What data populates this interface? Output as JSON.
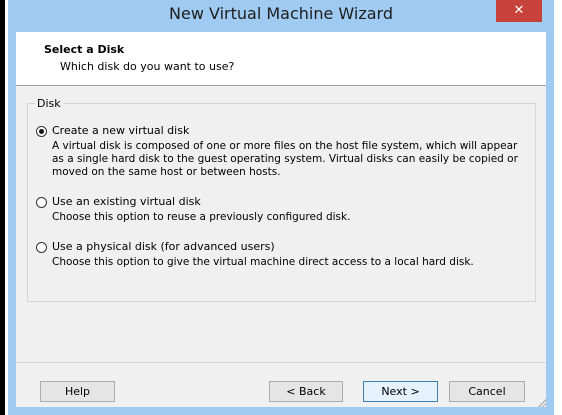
{
  "window": {
    "title": "New Virtual Machine Wizard",
    "close_glyph": "✕"
  },
  "header": {
    "title": "Select a Disk",
    "subtitle": "Which disk do you want to use?"
  },
  "disk_group": {
    "label": "Disk",
    "options": [
      {
        "label": "Create a new virtual disk",
        "description": "A virtual disk is composed of one or more files on the host file system, which will appear as a single hard disk to the guest operating system. Virtual disks can easily be copied or moved on the same host or between hosts.",
        "selected": true
      },
      {
        "label": "Use an existing virtual disk",
        "description": "Choose this option to reuse a previously configured disk.",
        "selected": false
      },
      {
        "label": "Use a physical disk (for advanced users)",
        "description": "Choose this option to give the virtual machine direct access to a local hard disk.",
        "selected": false
      }
    ]
  },
  "footer": {
    "help_label": "Help",
    "back_label": "< Back",
    "next_label": "Next >",
    "cancel_label": "Cancel"
  },
  "colors": {
    "title_bar": "#9fcbf2",
    "close_button": "#c7423a",
    "dialog_background": "#f0f0f0",
    "default_button_border": "#3c7fb1"
  }
}
